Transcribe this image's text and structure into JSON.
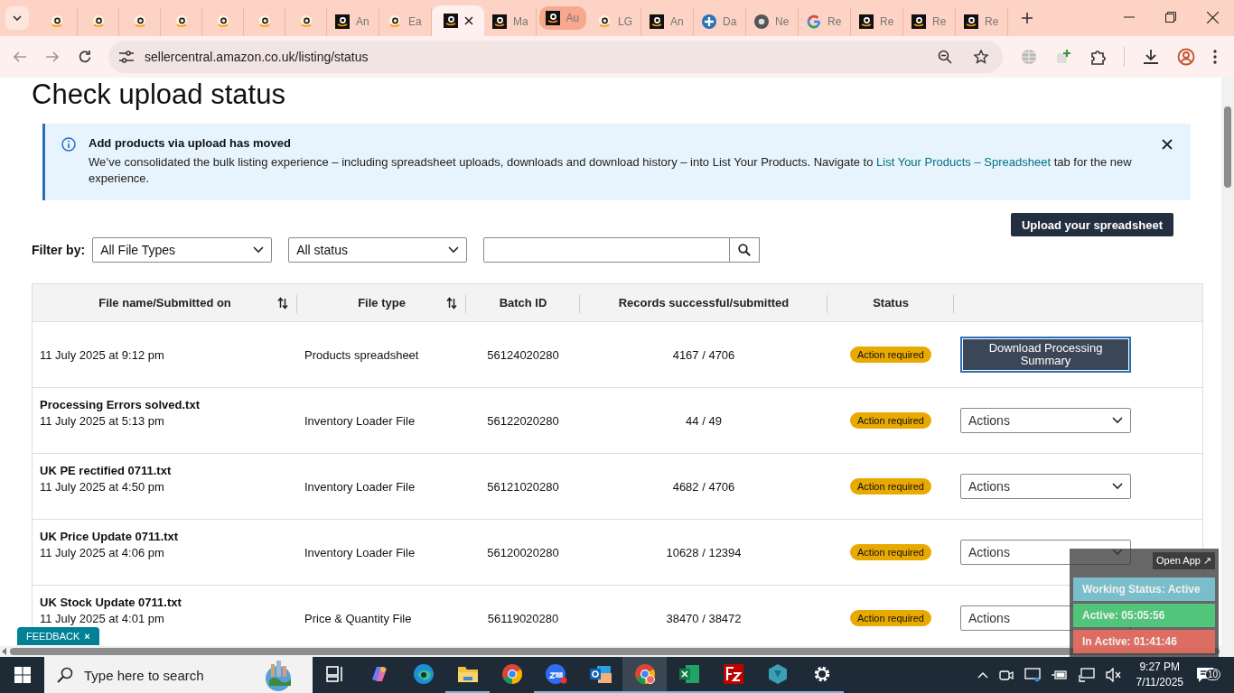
{
  "browser": {
    "tabs": [
      {
        "kind": "smile",
        "selected": false
      },
      {
        "kind": "smile",
        "selected": false
      },
      {
        "kind": "smile",
        "selected": false
      },
      {
        "kind": "smile",
        "selected": false
      },
      {
        "kind": "smile",
        "selected": false
      },
      {
        "kind": "smile",
        "selected": false
      },
      {
        "kind": "smile",
        "selected": false
      },
      {
        "kind": "box",
        "label": "An",
        "selected": false
      },
      {
        "kind": "smile",
        "label": "Ea",
        "selected": false
      },
      {
        "kind": "box",
        "selected": true
      },
      {
        "kind": "box",
        "label": "Ma",
        "selected": false
      },
      {
        "kind": "box",
        "label": "Au",
        "selected": false,
        "highlighted": true
      },
      {
        "kind": "smile",
        "label": "LG",
        "selected": false
      },
      {
        "kind": "box",
        "label": "An",
        "selected": false
      },
      {
        "kind": "cross",
        "label": "Da",
        "selected": false
      },
      {
        "kind": "chrome",
        "label": "Ne",
        "selected": false
      },
      {
        "kind": "google",
        "label": "Re",
        "selected": false
      },
      {
        "kind": "box",
        "label": "Re",
        "selected": false
      },
      {
        "kind": "box",
        "label": "Re",
        "selected": false
      },
      {
        "kind": "box",
        "label": "Re",
        "selected": false
      }
    ],
    "url": "sellercentral.amazon.co.uk/listing/status"
  },
  "page": {
    "title": "Check upload status",
    "banner": {
      "title": "Add products via upload has moved",
      "text": "We’ve consolidated the bulk listing experience – including spreadsheet uploads, downloads and download history – into List Your Products. Navigate to ",
      "link": "List Your Products – Spreadsheet",
      "text_after": " tab for the new experience."
    },
    "upload_button": "Upload your spreadsheet",
    "filter": {
      "label": "Filter by:",
      "file_type": "All File Types",
      "status": "All status"
    },
    "table": {
      "columns": [
        {
          "label": "File name/Submitted on",
          "sortable": true
        },
        {
          "label": "File type",
          "sortable": true
        },
        {
          "label": "Batch ID",
          "sortable": false
        },
        {
          "label": "Records successful/submitted",
          "sortable": false
        },
        {
          "label": "Status",
          "sortable": false
        }
      ],
      "rows": [
        {
          "date": "11 July 2025 at 9:12 pm",
          "type": "Products spreadsheet",
          "batch": "56124020280",
          "records": "4167 / 4706",
          "status": "Action required",
          "action": {
            "kind": "button",
            "label": "Download Processing Summary"
          }
        },
        {
          "name": "Processing Errors solved.txt",
          "date": "11 July 2025 at 5:13 pm",
          "type": "Inventory Loader File",
          "batch": "56122020280",
          "records": "44 / 49",
          "status": "Action required",
          "action": {
            "kind": "dropdown",
            "label": "Actions"
          }
        },
        {
          "name": "UK PE rectified 0711.txt",
          "date": "11 July 2025 at 4:50 pm",
          "type": "Inventory Loader File",
          "batch": "56121020280",
          "records": "4682 / 4706",
          "status": "Action required",
          "action": {
            "kind": "dropdown",
            "label": "Actions"
          }
        },
        {
          "name": "UK Price Update 0711.txt",
          "date": "11 July 2025 at 4:06 pm",
          "type": "Inventory Loader File",
          "batch": "56120020280",
          "records": "10628 / 12394",
          "status": "Action required",
          "action": {
            "kind": "dropdown",
            "label": "Actions"
          }
        },
        {
          "name": "UK Stock Update 0711.txt",
          "date": "11 July 2025 at 4:01 pm",
          "type": "Price & Quantity File",
          "batch": "56119020280",
          "records": "38470 / 38472",
          "status": "Action required",
          "action": {
            "kind": "dropdown",
            "label": "Actions"
          }
        }
      ]
    },
    "feedback": "FEEDBACK",
    "feedback_close": "×"
  },
  "tracker": {
    "open_app": "Open App ↗",
    "items": [
      {
        "text": "Working Status: Active",
        "color": "#7ec8d6"
      },
      {
        "text": "Active: 05:05:56",
        "color": "#4fd07c"
      },
      {
        "text": "In Active: 01:41:46",
        "color": "#ea6e62"
      }
    ]
  },
  "taskbar": {
    "search_placeholder": "Type here to search",
    "apps": [
      {
        "kind": "taskview",
        "running": false
      },
      {
        "kind": "copilot",
        "running": false
      },
      {
        "kind": "edge",
        "running": false
      },
      {
        "kind": "folder",
        "running": true
      },
      {
        "kind": "chrome",
        "running": false
      },
      {
        "kind": "zoom",
        "running": true
      },
      {
        "kind": "outlook",
        "running": true
      },
      {
        "kind": "chrome",
        "running": true,
        "active": true
      },
      {
        "kind": "excel",
        "running": true
      },
      {
        "kind": "filezilla",
        "running": true
      },
      {
        "kind": "hex",
        "running": true
      },
      {
        "kind": "gear",
        "running": true
      }
    ],
    "time": "9:27 PM",
    "date": "7/11/2025",
    "notifications": "10"
  }
}
